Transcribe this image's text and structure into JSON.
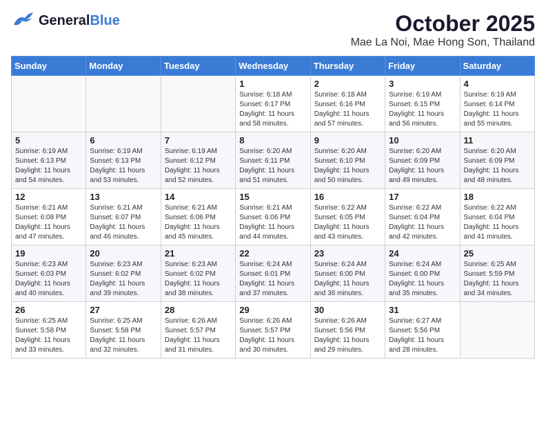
{
  "header": {
    "logo_general": "General",
    "logo_blue": "Blue",
    "title": "October 2025",
    "subtitle": "Mae La Noi, Mae Hong Son, Thailand"
  },
  "weekdays": [
    "Sunday",
    "Monday",
    "Tuesday",
    "Wednesday",
    "Thursday",
    "Friday",
    "Saturday"
  ],
  "weeks": [
    [
      {
        "day": "",
        "info": ""
      },
      {
        "day": "",
        "info": ""
      },
      {
        "day": "",
        "info": ""
      },
      {
        "day": "1",
        "info": "Sunrise: 6:18 AM\nSunset: 6:17 PM\nDaylight: 11 hours\nand 58 minutes."
      },
      {
        "day": "2",
        "info": "Sunrise: 6:18 AM\nSunset: 6:16 PM\nDaylight: 11 hours\nand 57 minutes."
      },
      {
        "day": "3",
        "info": "Sunrise: 6:19 AM\nSunset: 6:15 PM\nDaylight: 11 hours\nand 56 minutes."
      },
      {
        "day": "4",
        "info": "Sunrise: 6:19 AM\nSunset: 6:14 PM\nDaylight: 11 hours\nand 55 minutes."
      }
    ],
    [
      {
        "day": "5",
        "info": "Sunrise: 6:19 AM\nSunset: 6:13 PM\nDaylight: 11 hours\nand 54 minutes."
      },
      {
        "day": "6",
        "info": "Sunrise: 6:19 AM\nSunset: 6:13 PM\nDaylight: 11 hours\nand 53 minutes."
      },
      {
        "day": "7",
        "info": "Sunrise: 6:19 AM\nSunset: 6:12 PM\nDaylight: 11 hours\nand 52 minutes."
      },
      {
        "day": "8",
        "info": "Sunrise: 6:20 AM\nSunset: 6:11 PM\nDaylight: 11 hours\nand 51 minutes."
      },
      {
        "day": "9",
        "info": "Sunrise: 6:20 AM\nSunset: 6:10 PM\nDaylight: 11 hours\nand 50 minutes."
      },
      {
        "day": "10",
        "info": "Sunrise: 6:20 AM\nSunset: 6:09 PM\nDaylight: 11 hours\nand 49 minutes."
      },
      {
        "day": "11",
        "info": "Sunrise: 6:20 AM\nSunset: 6:09 PM\nDaylight: 11 hours\nand 48 minutes."
      }
    ],
    [
      {
        "day": "12",
        "info": "Sunrise: 6:21 AM\nSunset: 6:08 PM\nDaylight: 11 hours\nand 47 minutes."
      },
      {
        "day": "13",
        "info": "Sunrise: 6:21 AM\nSunset: 6:07 PM\nDaylight: 11 hours\nand 46 minutes."
      },
      {
        "day": "14",
        "info": "Sunrise: 6:21 AM\nSunset: 6:06 PM\nDaylight: 11 hours\nand 45 minutes."
      },
      {
        "day": "15",
        "info": "Sunrise: 6:21 AM\nSunset: 6:06 PM\nDaylight: 11 hours\nand 44 minutes."
      },
      {
        "day": "16",
        "info": "Sunrise: 6:22 AM\nSunset: 6:05 PM\nDaylight: 11 hours\nand 43 minutes."
      },
      {
        "day": "17",
        "info": "Sunrise: 6:22 AM\nSunset: 6:04 PM\nDaylight: 11 hours\nand 42 minutes."
      },
      {
        "day": "18",
        "info": "Sunrise: 6:22 AM\nSunset: 6:04 PM\nDaylight: 11 hours\nand 41 minutes."
      }
    ],
    [
      {
        "day": "19",
        "info": "Sunrise: 6:23 AM\nSunset: 6:03 PM\nDaylight: 11 hours\nand 40 minutes."
      },
      {
        "day": "20",
        "info": "Sunrise: 6:23 AM\nSunset: 6:02 PM\nDaylight: 11 hours\nand 39 minutes."
      },
      {
        "day": "21",
        "info": "Sunrise: 6:23 AM\nSunset: 6:02 PM\nDaylight: 11 hours\nand 38 minutes."
      },
      {
        "day": "22",
        "info": "Sunrise: 6:24 AM\nSunset: 6:01 PM\nDaylight: 11 hours\nand 37 minutes."
      },
      {
        "day": "23",
        "info": "Sunrise: 6:24 AM\nSunset: 6:00 PM\nDaylight: 11 hours\nand 36 minutes."
      },
      {
        "day": "24",
        "info": "Sunrise: 6:24 AM\nSunset: 6:00 PM\nDaylight: 11 hours\nand 35 minutes."
      },
      {
        "day": "25",
        "info": "Sunrise: 6:25 AM\nSunset: 5:59 PM\nDaylight: 11 hours\nand 34 minutes."
      }
    ],
    [
      {
        "day": "26",
        "info": "Sunrise: 6:25 AM\nSunset: 5:58 PM\nDaylight: 11 hours\nand 33 minutes."
      },
      {
        "day": "27",
        "info": "Sunrise: 6:25 AM\nSunset: 5:58 PM\nDaylight: 11 hours\nand 32 minutes."
      },
      {
        "day": "28",
        "info": "Sunrise: 6:26 AM\nSunset: 5:57 PM\nDaylight: 11 hours\nand 31 minutes."
      },
      {
        "day": "29",
        "info": "Sunrise: 6:26 AM\nSunset: 5:57 PM\nDaylight: 11 hours\nand 30 minutes."
      },
      {
        "day": "30",
        "info": "Sunrise: 6:26 AM\nSunset: 5:56 PM\nDaylight: 11 hours\nand 29 minutes."
      },
      {
        "day": "31",
        "info": "Sunrise: 6:27 AM\nSunset: 5:56 PM\nDaylight: 11 hours\nand 28 minutes."
      },
      {
        "day": "",
        "info": ""
      }
    ]
  ]
}
